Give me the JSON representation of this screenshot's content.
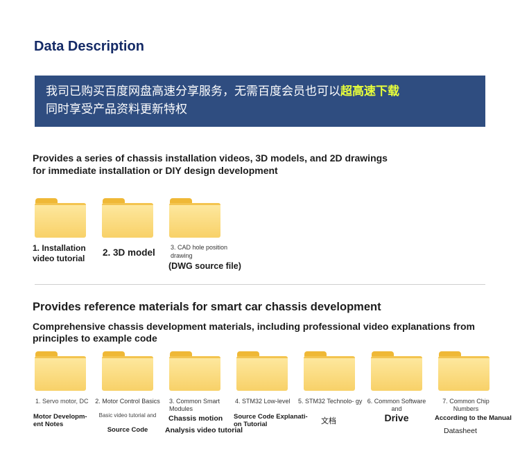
{
  "title": "Data Description",
  "banner": {
    "line1_prefix": "我司已购买百度网盘高速分享服务，无需百度会员也可以",
    "line1_highlight": "超高速下载",
    "line2": "同时享受产品资料更新特权"
  },
  "section1": {
    "heading": "Provides a series of chassis installation videos, 3D models, and 2D drawings for immediate installation or DIY design development",
    "items": [
      {
        "label": "1. Installation video tutorial"
      },
      {
        "label": "2. 3D model"
      },
      {
        "label_small": "3. CAD hole position drawing",
        "label_large": "(DWG source file)"
      }
    ]
  },
  "section2": {
    "heading": "Provides reference materials for smart car chassis development",
    "subheading": "Comprehensive chassis development materials, including professional video explanations from principles to example code",
    "items": [
      {
        "top": "1. Servo motor, DC",
        "bottom": "Motor Developm- ent Notes"
      },
      {
        "top": "2. Motor Control Basics",
        "mid": "Basic video tutorial and",
        "bottom": "Source Code"
      },
      {
        "top": "3. Common Smart Modules",
        "mid": "Chassis motion",
        "bottom": "Analysis video tutorial"
      },
      {
        "top": "4. STM32 Low-level",
        "bottom": "Source Code Explanati- on Tutorial"
      },
      {
        "top": "5. STM32 Technolo- gy",
        "bottom": "文档"
      },
      {
        "top": "6. Common Software and",
        "bottom": "Drive"
      },
      {
        "top": "7. Common Chip Numbers",
        "mid": "According to the Manual",
        "bottom": "Datasheet"
      }
    ]
  }
}
